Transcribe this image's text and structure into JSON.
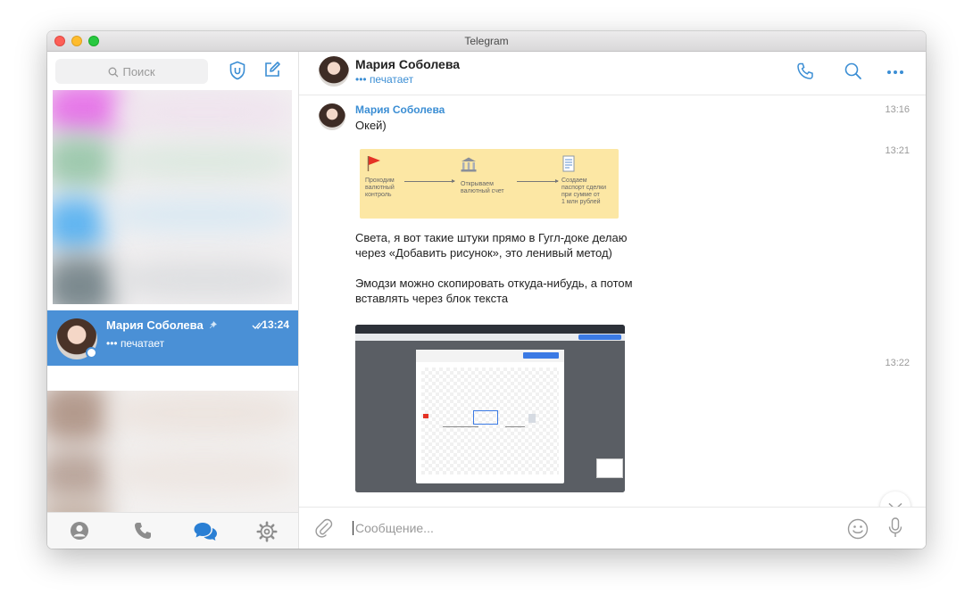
{
  "window": {
    "title": "Telegram"
  },
  "sidebar": {
    "search_placeholder": "Поиск",
    "active_chat": {
      "name": "Мария Соболева",
      "time": "13:24",
      "status": "••• печатает"
    }
  },
  "chat": {
    "header": {
      "name": "Мария Соболева",
      "status": "••• печатает"
    },
    "messages": [
      {
        "sender": "Мария Соболева",
        "text": "Окей)",
        "time": "13:16"
      },
      {
        "time": "13:21",
        "image_steps": [
          "Проходим\nвалютный\nконтроль",
          "Открываем\nвалютный счет",
          "Создаем\nпаспорт сделки\nпри сумме от\n1 млн рублей"
        ],
        "text": "Света, я вот такие штуки прямо в Гугл-доке делаю через «Добавить рисунок», это ленивый метод)\n\nЭмодзи можно скопировать откуда-нибудь, а потом вставлять через блок текста"
      },
      {
        "time": "13:22"
      }
    ],
    "composer_placeholder": "Сообщение..."
  },
  "colors": {
    "accent": "#4a90d6",
    "link": "#3b8ed4",
    "image_bg": "#fce7a4"
  }
}
